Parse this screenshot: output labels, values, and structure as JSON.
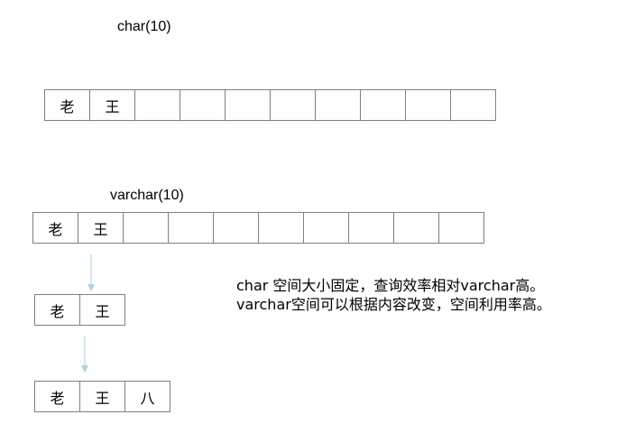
{
  "char_section": {
    "title": "char(10)",
    "cells": [
      "老",
      "王",
      "",
      "",
      "",
      "",
      "",
      "",
      "",
      ""
    ]
  },
  "varchar_section": {
    "title": "varchar(10)",
    "cells": [
      "老",
      "王",
      "",
      "",
      "",
      "",
      "",
      "",
      "",
      ""
    ],
    "step1_cells": [
      "老",
      "王"
    ],
    "step2_cells": [
      "老",
      "王",
      "八"
    ]
  },
  "notes": {
    "line1": "char 空间大小固定，查询效率相对varchar高。",
    "line2": "varchar空间可以根据内容改变，空间利用率高。"
  },
  "colors": {
    "border": "#7f7f7f",
    "arrow": "#a9d3de"
  }
}
